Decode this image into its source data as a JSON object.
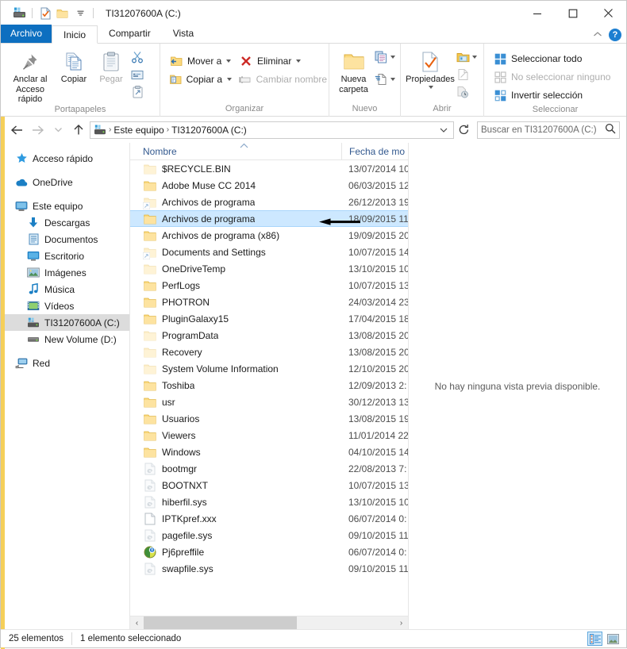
{
  "window": {
    "title": "TI31207600A (C:)",
    "minimize_label": "Minimizar",
    "maximize_label": "Maximizar",
    "close_label": "Cerrar",
    "collapse_ribbon_label": "Minimizar la cinta de opciones",
    "help_label": "?"
  },
  "quick_access_toolbar": {
    "items": [
      {
        "icon": "drive-icon",
        "name": "drive-icon"
      },
      {
        "icon": "properties-icon",
        "name": "properties-icon"
      },
      {
        "icon": "new-folder-icon",
        "name": "new-folder-icon"
      },
      {
        "icon": "chevron-down-icon",
        "name": "customize-qat-chevron-icon"
      }
    ]
  },
  "ribbon": {
    "tabs": [
      {
        "label": "Archivo",
        "active": false,
        "file": true
      },
      {
        "label": "Inicio",
        "active": true,
        "file": false
      },
      {
        "label": "Compartir",
        "active": false,
        "file": false
      },
      {
        "label": "Vista",
        "active": false,
        "file": false
      }
    ],
    "groups": [
      {
        "label": "Portapapeles",
        "big_buttons": [
          {
            "label_line1": "Anclar al",
            "label_line2": "Acceso rápido",
            "icon": "pin-icon",
            "disabled": false
          },
          {
            "label_line1": "Copiar",
            "label_line2": "",
            "icon": "copy-icon",
            "disabled": false
          },
          {
            "label_line1": "Pegar",
            "label_line2": "",
            "icon": "paste-icon",
            "disabled": true
          }
        ],
        "small_icons": [
          {
            "name": "cut-icon",
            "tooltip": "Cortar"
          },
          {
            "name": "copy-path-icon",
            "tooltip": "Copiar ruta de acceso"
          },
          {
            "name": "paste-shortcut-icon",
            "tooltip": "Pegar acceso directo"
          }
        ]
      },
      {
        "label": "Organizar",
        "small_buttons": [
          {
            "label": "Mover a",
            "icon": "move-to-icon",
            "has_caret": true,
            "disabled": false
          },
          {
            "label": "Eliminar",
            "icon": "delete-icon",
            "has_caret": true,
            "disabled": false
          },
          {
            "label": "Copiar a",
            "icon": "copy-to-icon",
            "has_caret": true,
            "disabled": false
          },
          {
            "label": "Cambiar nombre",
            "icon": "rename-icon",
            "has_caret": false,
            "disabled": true
          }
        ]
      },
      {
        "label": "Nuevo",
        "big_buttons": [
          {
            "label_line1": "Nueva",
            "label_line2": "carpeta",
            "icon": "new-folder-icon",
            "disabled": false
          }
        ],
        "small_icons": [
          {
            "name": "new-item-icon",
            "tooltip": "Nuevo elemento",
            "has_caret": true
          },
          {
            "name": "easy-access-icon",
            "tooltip": "Fácil acceso",
            "has_caret": true
          }
        ]
      },
      {
        "label": "Abrir",
        "big_buttons": [
          {
            "label_line1": "Propiedades",
            "label_line2": "",
            "icon": "properties-icon",
            "disabled": false,
            "has_caret": true
          }
        ],
        "small_icons": [
          {
            "name": "open-icon",
            "tooltip": "Abrir",
            "has_caret": true
          },
          {
            "name": "edit-icon",
            "tooltip": "Editar",
            "disabled": true
          },
          {
            "name": "history-icon",
            "tooltip": "Historial",
            "disabled": true
          }
        ]
      },
      {
        "label": "Seleccionar",
        "small_buttons": [
          {
            "label": "Seleccionar todo",
            "icon": "select-all-icon",
            "disabled": false
          },
          {
            "label": "No seleccionar ninguno",
            "icon": "select-none-icon",
            "disabled": true
          },
          {
            "label": "Invertir selección",
            "icon": "invert-selection-icon",
            "disabled": false
          }
        ]
      }
    ]
  },
  "address_bar": {
    "back_label": "Atrás",
    "forward_label": "Adelante",
    "recent_label": "Ubicaciones recientes",
    "up_label": "Subir un nivel",
    "breadcrumbs": [
      {
        "label": "Este equipo"
      },
      {
        "label": "TI31207600A (C:)"
      }
    ],
    "refresh_label": "Actualizar",
    "dropdown_label": "Historial de ubicaciones"
  },
  "search": {
    "placeholder": "Buscar en TI31207600A (C:)",
    "icon": "search-icon"
  },
  "navigation_pane": {
    "items": [
      {
        "label": "Acceso rápido",
        "icon": "star-icon",
        "level": 1,
        "selected": false,
        "gap_after": true
      },
      {
        "label": "OneDrive",
        "icon": "cloud-icon",
        "level": 1,
        "selected": false,
        "gap_after": true
      },
      {
        "label": "Este equipo",
        "icon": "computer-icon",
        "level": 1,
        "selected": false,
        "gap_after": false
      },
      {
        "label": "Descargas",
        "icon": "downloads-icon",
        "level": 2,
        "selected": false,
        "gap_after": false
      },
      {
        "label": "Documentos",
        "icon": "documents-icon",
        "level": 2,
        "selected": false,
        "gap_after": false
      },
      {
        "label": "Escritorio",
        "icon": "desktop-icon",
        "level": 2,
        "selected": false,
        "gap_after": false
      },
      {
        "label": "Imágenes",
        "icon": "pictures-icon",
        "level": 2,
        "selected": false,
        "gap_after": false
      },
      {
        "label": "Música",
        "icon": "music-icon",
        "level": 2,
        "selected": false,
        "gap_after": false
      },
      {
        "label": "Vídeos",
        "icon": "videos-icon",
        "level": 2,
        "selected": false,
        "gap_after": false
      },
      {
        "label": "TI31207600A (C:)",
        "icon": "drive-icon",
        "level": 2,
        "selected": true,
        "gap_after": false
      },
      {
        "label": "New Volume (D:)",
        "icon": "drive-icon",
        "level": 2,
        "selected": false,
        "gap_after": true
      },
      {
        "label": "Red",
        "icon": "network-icon",
        "level": 1,
        "selected": false,
        "gap_after": false
      }
    ]
  },
  "file_list": {
    "columns": [
      {
        "label": "Nombre",
        "sorted": true,
        "sort_direction": "asc"
      },
      {
        "label": "Fecha de mo",
        "sorted": false,
        "sort_direction": ""
      }
    ],
    "rows": [
      {
        "name": "$RECYCLE.BIN",
        "date": "13/07/2014 10",
        "icon": "folder-icon",
        "ghost": true,
        "shortcut": false,
        "selected": false
      },
      {
        "name": "Adobe Muse CC 2014",
        "date": "06/03/2015 12",
        "icon": "folder-icon",
        "ghost": false,
        "shortcut": false,
        "selected": false
      },
      {
        "name": "Archivos de programa",
        "date": "26/12/2013 19",
        "icon": "folder-icon",
        "ghost": true,
        "shortcut": true,
        "selected": false
      },
      {
        "name": "Archivos de programa",
        "date": "18/09/2015 11",
        "icon": "folder-icon",
        "ghost": false,
        "shortcut": false,
        "selected": true
      },
      {
        "name": "Archivos de programa (x86)",
        "date": "19/09/2015 20",
        "icon": "folder-icon",
        "ghost": false,
        "shortcut": false,
        "selected": false
      },
      {
        "name": "Documents and Settings",
        "date": "10/07/2015 14",
        "icon": "folder-icon",
        "ghost": true,
        "shortcut": true,
        "selected": false
      },
      {
        "name": "OneDriveTemp",
        "date": "13/10/2015 10",
        "icon": "folder-icon",
        "ghost": true,
        "shortcut": false,
        "selected": false
      },
      {
        "name": "PerfLogs",
        "date": "10/07/2015 13",
        "icon": "folder-icon",
        "ghost": false,
        "shortcut": false,
        "selected": false
      },
      {
        "name": "PHOTRON",
        "date": "24/03/2014 23",
        "icon": "folder-icon",
        "ghost": false,
        "shortcut": false,
        "selected": false
      },
      {
        "name": "PluginGalaxy15",
        "date": "17/04/2015 18",
        "icon": "folder-icon",
        "ghost": false,
        "shortcut": false,
        "selected": false
      },
      {
        "name": "ProgramData",
        "date": "13/08/2015 20",
        "icon": "folder-icon",
        "ghost": true,
        "shortcut": false,
        "selected": false
      },
      {
        "name": "Recovery",
        "date": "13/08/2015 20",
        "icon": "folder-icon",
        "ghost": true,
        "shortcut": false,
        "selected": false
      },
      {
        "name": "System Volume Information",
        "date": "12/10/2015 20",
        "icon": "folder-icon",
        "ghost": true,
        "shortcut": false,
        "selected": false
      },
      {
        "name": "Toshiba",
        "date": "12/09/2013 2:",
        "icon": "folder-icon",
        "ghost": false,
        "shortcut": false,
        "selected": false
      },
      {
        "name": "usr",
        "date": "30/12/2013 13",
        "icon": "folder-icon",
        "ghost": false,
        "shortcut": false,
        "selected": false
      },
      {
        "name": "Usuarios",
        "date": "13/08/2015 19",
        "icon": "folder-icon",
        "ghost": false,
        "shortcut": false,
        "selected": false
      },
      {
        "name": "Viewers",
        "date": "11/01/2014 22",
        "icon": "folder-icon",
        "ghost": false,
        "shortcut": false,
        "selected": false
      },
      {
        "name": "Windows",
        "date": "04/10/2015 14",
        "icon": "folder-icon",
        "ghost": false,
        "shortcut": false,
        "selected": false
      },
      {
        "name": "bootmgr",
        "date": "22/08/2013 7:",
        "icon": "system-file-icon",
        "ghost": true,
        "shortcut": false,
        "selected": false
      },
      {
        "name": "BOOTNXT",
        "date": "10/07/2015 13",
        "icon": "system-file-icon",
        "ghost": true,
        "shortcut": false,
        "selected": false
      },
      {
        "name": "hiberfil.sys",
        "date": "13/10/2015 10",
        "icon": "system-file-icon",
        "ghost": true,
        "shortcut": false,
        "selected": false
      },
      {
        "name": "IPTKpref.xxx",
        "date": "06/07/2014 0:",
        "icon": "blank-file-icon",
        "ghost": false,
        "shortcut": false,
        "selected": false
      },
      {
        "name": "pagefile.sys",
        "date": "09/10/2015 11",
        "icon": "system-file-icon",
        "ghost": true,
        "shortcut": false,
        "selected": false
      },
      {
        "name": "Pj6preffile",
        "date": "06/07/2014 0:",
        "icon": "unknown-app-icon",
        "ghost": false,
        "shortcut": false,
        "selected": false
      },
      {
        "name": "swapfile.sys",
        "date": "09/10/2015 11",
        "icon": "system-file-icon",
        "ghost": true,
        "shortcut": false,
        "selected": false
      }
    ],
    "annotation": {
      "type": "arrow-left",
      "points_to_row": 3,
      "color": "#000000"
    }
  },
  "preview_pane": {
    "message": "No hay ninguna vista previa disponible."
  },
  "status_bar": {
    "item_count": "25 elementos",
    "selection": "1 elemento seleccionado",
    "view_buttons": [
      {
        "name": "details-view-button",
        "label": "Detalles",
        "active": true
      },
      {
        "name": "large-icons-view-button",
        "label": "Iconos grandes",
        "active": false
      }
    ]
  },
  "scrollbar": {
    "left_arrow": "‹",
    "right_arrow": "›"
  },
  "colors": {
    "accent": "#0d6fc0",
    "selection": "#cde8ff",
    "selection_border": "#a8d5fb",
    "nav_selection": "#dcdcdc",
    "column_header_text": "#33598f",
    "folder": "#fcd77a"
  }
}
